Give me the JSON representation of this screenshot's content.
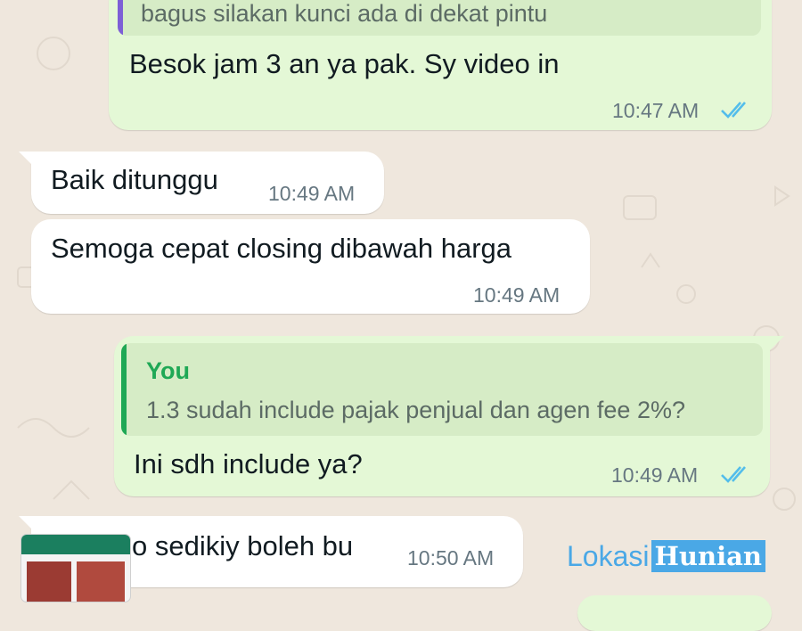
{
  "colors": {
    "background": "#efe7dd",
    "outgoing_bubble": "#e4f8d6",
    "incoming_bubble": "#ffffff",
    "read_ticks": "#53bdeb",
    "quote_author": "#1fa855",
    "watermark": "#4aa8e6"
  },
  "messages": [
    {
      "direction": "outgoing",
      "quote_text": "bagus silakan kunci ada di dekat pintu",
      "text": "Besok jam 3 an ya pak. Sy video in",
      "time": "10:47 AM",
      "status": "read"
    },
    {
      "direction": "incoming",
      "text": "Baik ditunggu",
      "time": "10:49 AM"
    },
    {
      "direction": "incoming",
      "text": "Semoga cepat closing dibawah harga",
      "time": "10:49 AM"
    },
    {
      "direction": "outgoing",
      "quote_author": "You",
      "quote_text": "1.3 sudah include pajak penjual dan agen fee 2%?",
      "text": "Ini sdh include ya?",
      "time": "10:49 AM",
      "status": "read"
    },
    {
      "direction": "incoming",
      "text": "o sedikiy boleh bu",
      "time": "10:50 AM"
    }
  ],
  "watermark": {
    "part1": "Lokasi",
    "part2": "Hunian"
  }
}
